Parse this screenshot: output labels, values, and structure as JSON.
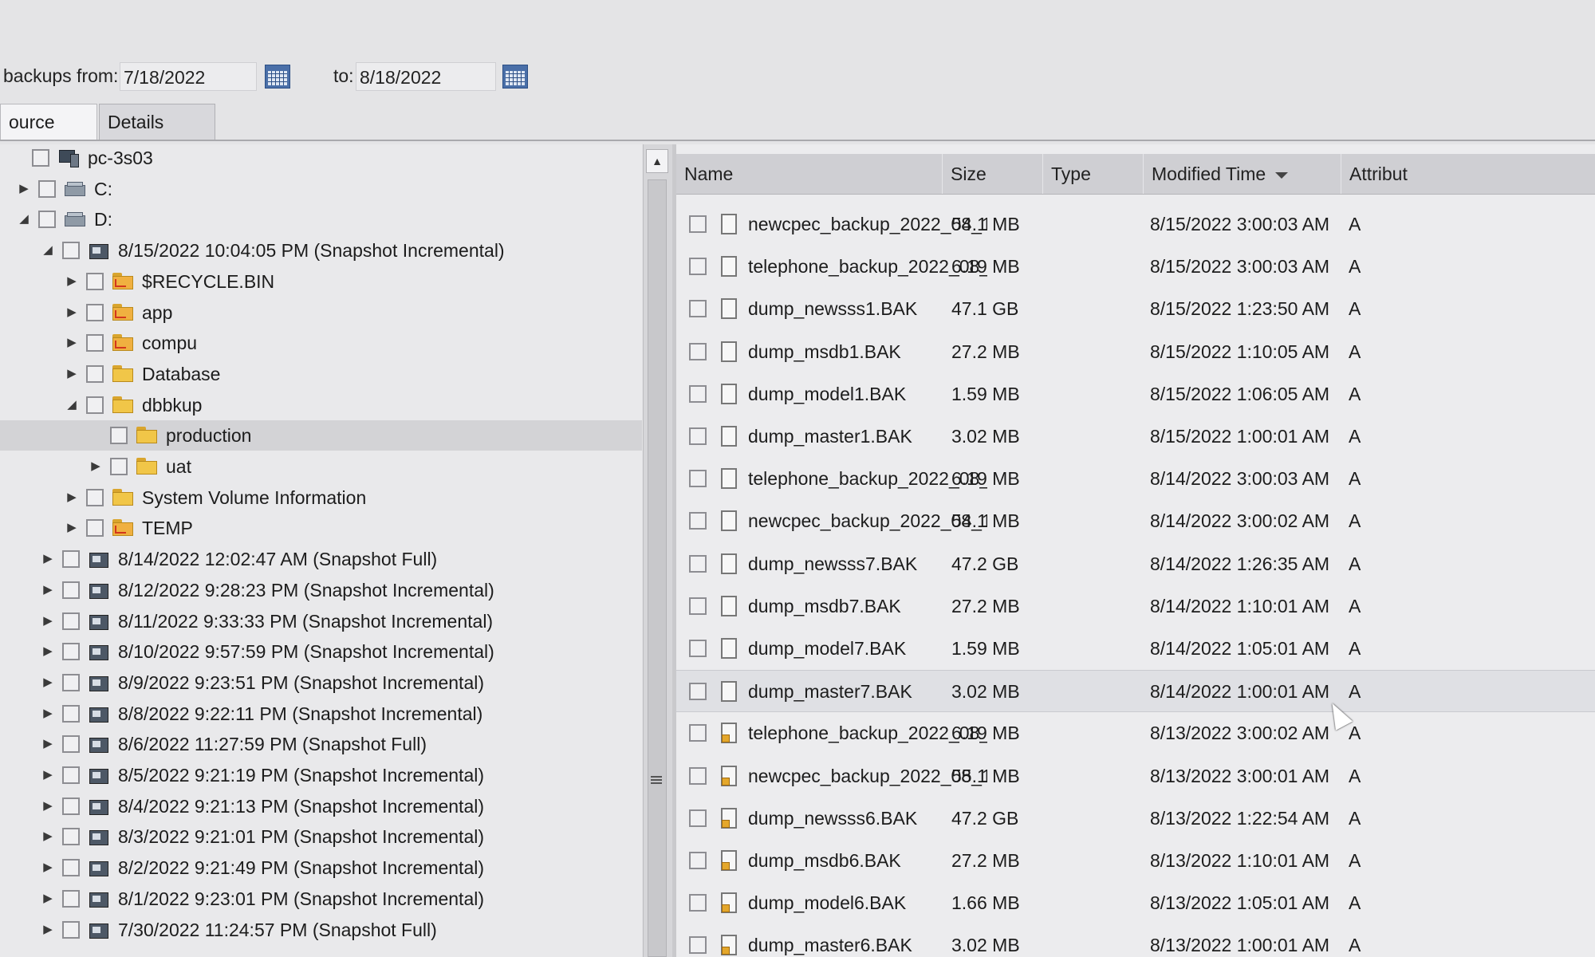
{
  "date_range": {
    "from_label": "backups from:",
    "from_value": "7/18/2022",
    "to_label": "to:",
    "to_value": "8/18/2022"
  },
  "tabs": [
    {
      "label": "ource View",
      "active": true
    },
    {
      "label": "Details View",
      "active": false
    }
  ],
  "tree": [
    {
      "label": "pc-3s03",
      "icon": "computer-icon",
      "level": 0,
      "expander": "none"
    },
    {
      "label": "C:",
      "icon": "drive-icon",
      "level": 1,
      "expander": "collapsed"
    },
    {
      "label": "D:",
      "icon": "drive-icon",
      "level": 1,
      "expander": "expanded"
    },
    {
      "label": "8/15/2022 10:04:05 PM (Snapshot Incremental)",
      "icon": "snapshot-icon",
      "level": 2,
      "expander": "expanded"
    },
    {
      "label": "$RECYCLE.BIN",
      "icon": "shared-folder-icon",
      "level": 3,
      "expander": "collapsed"
    },
    {
      "label": "app",
      "icon": "shared-folder-icon",
      "level": 3,
      "expander": "collapsed"
    },
    {
      "label": "compu",
      "icon": "shared-folder-icon",
      "level": 3,
      "expander": "collapsed"
    },
    {
      "label": "Database",
      "icon": "folder-icon",
      "level": 3,
      "expander": "collapsed"
    },
    {
      "label": "dbbkup",
      "icon": "folder-icon",
      "level": 3,
      "expander": "expanded"
    },
    {
      "label": "production",
      "icon": "folder-icon",
      "level": 4,
      "expander": "none",
      "selected": true
    },
    {
      "label": "uat",
      "icon": "folder-icon",
      "level": 4,
      "expander": "collapsed"
    },
    {
      "label": "System Volume Information",
      "icon": "folder-icon",
      "level": 3,
      "expander": "collapsed"
    },
    {
      "label": "TEMP",
      "icon": "shared-folder-icon",
      "level": 3,
      "expander": "collapsed"
    },
    {
      "label": "8/14/2022 12:02:47 AM (Snapshot Full)",
      "icon": "snapshot-icon",
      "level": 2,
      "expander": "collapsed"
    },
    {
      "label": "8/12/2022 9:28:23 PM (Snapshot Incremental)",
      "icon": "snapshot-icon",
      "level": 2,
      "expander": "collapsed"
    },
    {
      "label": "8/11/2022 9:33:33 PM (Snapshot Incremental)",
      "icon": "snapshot-icon",
      "level": 2,
      "expander": "collapsed"
    },
    {
      "label": "8/10/2022 9:57:59 PM (Snapshot Incremental)",
      "icon": "snapshot-icon",
      "level": 2,
      "expander": "collapsed"
    },
    {
      "label": "8/9/2022 9:23:51 PM (Snapshot Incremental)",
      "icon": "snapshot-icon",
      "level": 2,
      "expander": "collapsed"
    },
    {
      "label": "8/8/2022 9:22:11 PM (Snapshot Incremental)",
      "icon": "snapshot-icon",
      "level": 2,
      "expander": "collapsed"
    },
    {
      "label": "8/6/2022 11:27:59 PM (Snapshot Full)",
      "icon": "snapshot-icon",
      "level": 2,
      "expander": "collapsed"
    },
    {
      "label": "8/5/2022 9:21:19 PM (Snapshot Incremental)",
      "icon": "snapshot-icon",
      "level": 2,
      "expander": "collapsed"
    },
    {
      "label": "8/4/2022 9:21:13 PM (Snapshot Incremental)",
      "icon": "snapshot-icon",
      "level": 2,
      "expander": "collapsed"
    },
    {
      "label": "8/3/2022 9:21:01 PM (Snapshot Incremental)",
      "icon": "snapshot-icon",
      "level": 2,
      "expander": "collapsed"
    },
    {
      "label": "8/2/2022 9:21:49 PM (Snapshot Incremental)",
      "icon": "snapshot-icon",
      "level": 2,
      "expander": "collapsed"
    },
    {
      "label": "8/1/2022 9:23:01 PM (Snapshot Incremental)",
      "icon": "snapshot-icon",
      "level": 2,
      "expander": "collapsed"
    },
    {
      "label": "7/30/2022 11:24:57 PM (Snapshot Full)",
      "icon": "snapshot-icon",
      "level": 2,
      "expander": "collapsed"
    }
  ],
  "columns": {
    "name": "Name",
    "size": "Size",
    "type": "Type",
    "modified": "Modified Time",
    "attributes": "Attribut"
  },
  "files": [
    {
      "name": "newcpec_backup_2022_08_15_...",
      "size": "54.1 MB",
      "modified": "8/15/2022 3:00:03 AM",
      "attr": "A",
      "icon": "file-icon"
    },
    {
      "name": "telephone_backup_2022_08_1...",
      "size": "6.19 MB",
      "modified": "8/15/2022 3:00:03 AM",
      "attr": "A",
      "icon": "file-icon"
    },
    {
      "name": "dump_newsss1.BAK",
      "size": "47.1 GB",
      "modified": "8/15/2022 1:23:50 AM",
      "attr": "A",
      "icon": "file-icon"
    },
    {
      "name": "dump_msdb1.BAK",
      "size": "27.2 MB",
      "modified": "8/15/2022 1:10:05 AM",
      "attr": "A",
      "icon": "file-icon"
    },
    {
      "name": "dump_model1.BAK",
      "size": "1.59 MB",
      "modified": "8/15/2022 1:06:05 AM",
      "attr": "A",
      "icon": "file-icon"
    },
    {
      "name": "dump_master1.BAK",
      "size": "3.02 MB",
      "modified": "8/15/2022 1:00:01 AM",
      "attr": "A",
      "icon": "file-icon"
    },
    {
      "name": "telephone_backup_2022_08_1...",
      "size": "6.19 MB",
      "modified": "8/14/2022 3:00:03 AM",
      "attr": "A",
      "icon": "file-icon"
    },
    {
      "name": "newcpec_backup_2022_08_14_...",
      "size": "54.1 MB",
      "modified": "8/14/2022 3:00:02 AM",
      "attr": "A",
      "icon": "file-icon"
    },
    {
      "name": "dump_newsss7.BAK",
      "size": "47.2 GB",
      "modified": "8/14/2022 1:26:35 AM",
      "attr": "A",
      "icon": "file-icon"
    },
    {
      "name": "dump_msdb7.BAK",
      "size": "27.2 MB",
      "modified": "8/14/2022 1:10:01 AM",
      "attr": "A",
      "icon": "file-icon"
    },
    {
      "name": "dump_model7.BAK",
      "size": "1.59 MB",
      "modified": "8/14/2022 1:05:01 AM",
      "attr": "A",
      "icon": "file-icon"
    },
    {
      "name": "dump_master7.BAK",
      "size": "3.02 MB",
      "modified": "8/14/2022 1:00:01 AM",
      "attr": "A",
      "icon": "file-icon",
      "hover": true
    },
    {
      "name": "telephone_backup_2022_08_1...",
      "size": "6.19 MB",
      "modified": "8/13/2022 3:00:02 AM",
      "attr": "A",
      "icon": "archived-file-icon"
    },
    {
      "name": "newcpec_backup_2022_08_13_...",
      "size": "55.1 MB",
      "modified": "8/13/2022 3:00:01 AM",
      "attr": "A",
      "icon": "archived-file-icon"
    },
    {
      "name": "dump_newsss6.BAK",
      "size": "47.2 GB",
      "modified": "8/13/2022 1:22:54 AM",
      "attr": "A",
      "icon": "archived-file-icon"
    },
    {
      "name": "dump_msdb6.BAK",
      "size": "27.2 MB",
      "modified": "8/13/2022 1:10:01 AM",
      "attr": "A",
      "icon": "archived-file-icon"
    },
    {
      "name": "dump_model6.BAK",
      "size": "1.66 MB",
      "modified": "8/13/2022 1:05:01 AM",
      "attr": "A",
      "icon": "archived-file-icon"
    },
    {
      "name": "dump_master6.BAK",
      "size": "3.02 MB",
      "modified": "8/13/2022 1:00:01 AM",
      "attr": "A",
      "icon": "archived-file-icon"
    }
  ]
}
